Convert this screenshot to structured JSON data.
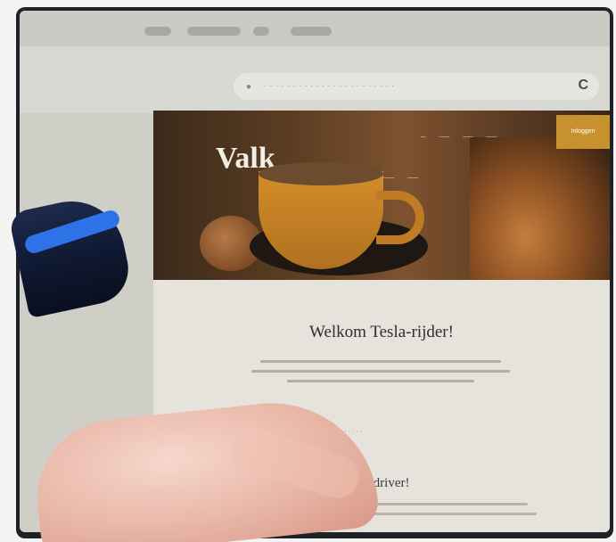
{
  "browser": {
    "reload_icon": "reload-icon",
    "lock_icon": "lock-icon"
  },
  "website": {
    "logo": "Valk",
    "cta_button_label": "Inloggen",
    "welcome_heading": "Welkom Tesla-rijder!",
    "welcome_heading_2": "sla-driver!"
  },
  "colors": {
    "cta": "#c7912e",
    "hero_dark": "#3b2a1b",
    "page_bg": "#e6e3dc"
  }
}
